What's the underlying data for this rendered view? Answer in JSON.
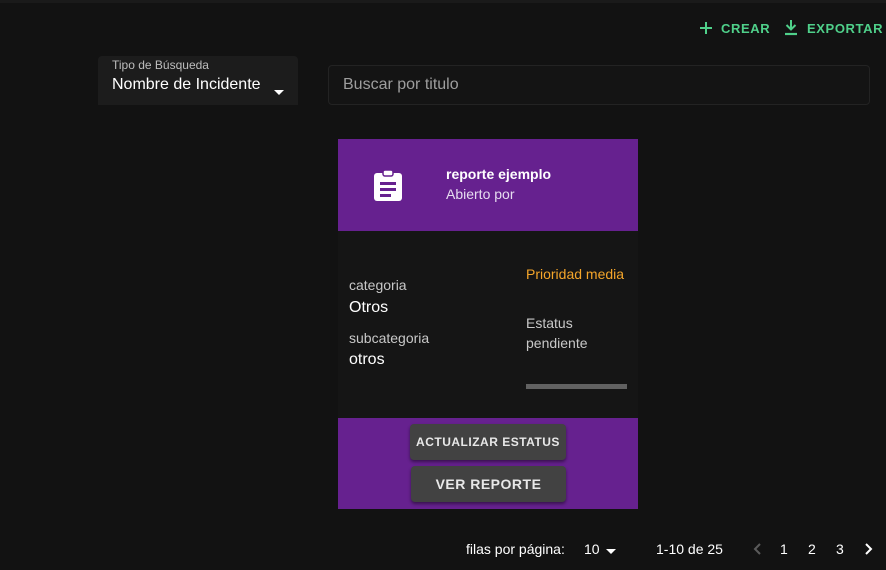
{
  "toolbar": {
    "create_label": "CREAR",
    "export_label": "EXPORTAR",
    "create_icon": "plus-icon",
    "export_icon": "download-icon",
    "accent_color": "#4fd08a"
  },
  "search": {
    "type_label": "Tipo de Búsqueda",
    "type_value": "Nombre de Incidente",
    "placeholder": "Buscar por titulo",
    "value": ""
  },
  "card": {
    "icon": "clipboard-text-icon",
    "title": "reporte ejemplo",
    "subtitle": "Abierto por",
    "category_label": "categoria",
    "category_value": "Otros",
    "subcategory_label": "subcategoria",
    "subcategory_value": "otros",
    "priority": "Prioridad media",
    "status_label": "Estatus",
    "status_value": "pendiente",
    "progress_fraction": 0,
    "update_status_label": "ACTUALIZAR ESTATUS",
    "view_report_label": "VER REPORTE",
    "header_color": "#66218f",
    "priority_color": "#f4a52a"
  },
  "pagination": {
    "rows_per_page_label": "filas por página:",
    "rows_per_page_value": "10",
    "range": "1-10 de 25",
    "pages": [
      "1",
      "2",
      "3"
    ]
  }
}
